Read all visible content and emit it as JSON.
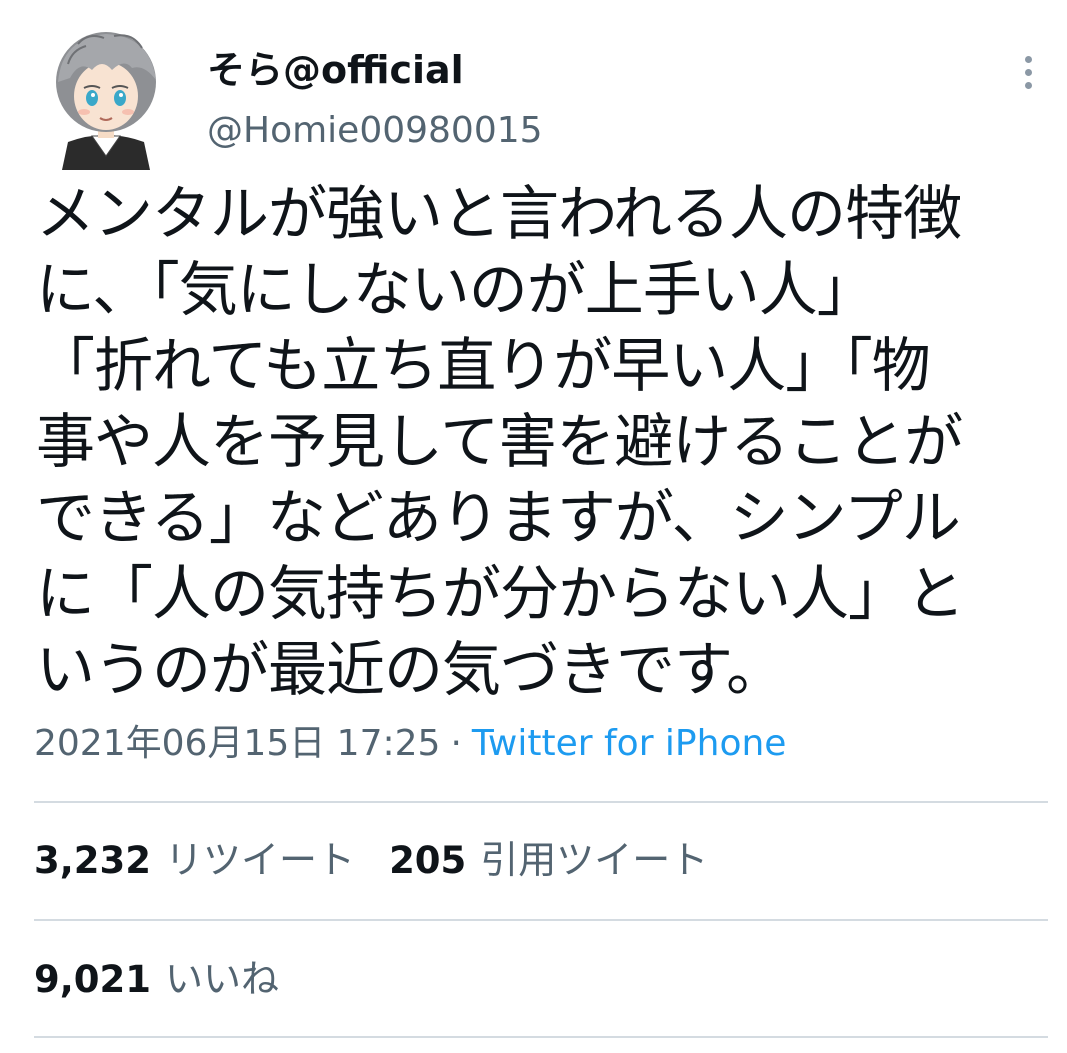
{
  "author": {
    "display_name": "そら@official",
    "handle": "@Homie00980015",
    "avatar_icon": "anime-avatar-icon"
  },
  "menu_icon": "more-vertical-icon",
  "tweet": {
    "text_lines": [
      "メンタルが強いと言われる人の特徴",
      "に、「気にしないのが上手い人」",
      "「折れても立ち直りが早い人」「物",
      "事や人を予見して害を避けることが",
      "できる」などありますが、シンプル",
      "に「人の気持ちが分からない人」と",
      "いうのが最近の気づきです。"
    ],
    "timestamp": "2021年06月15日 17:25",
    "separator": "·",
    "source": "Twitter for iPhone"
  },
  "stats": {
    "retweets_count": "3,232",
    "retweets_label": "リツイート",
    "quotes_count": "205",
    "quotes_label": "引用ツイート",
    "likes_count": "9,021",
    "likes_label": "いいね"
  },
  "colors": {
    "text": "#0f1419",
    "secondary": "#536471",
    "link": "#1d9bf0",
    "divider": "#d4dbe1"
  }
}
